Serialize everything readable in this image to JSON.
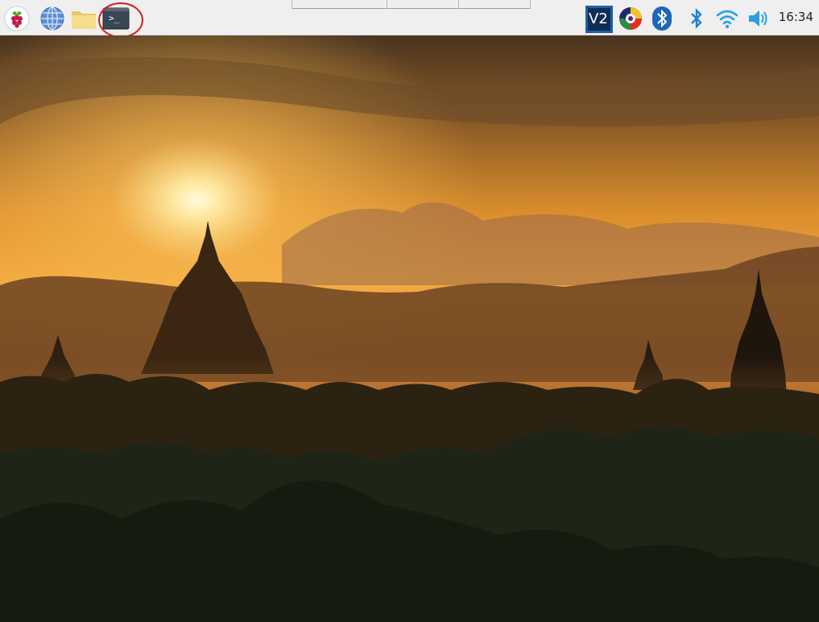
{
  "taskbar": {
    "launchers": [
      {
        "icon": "raspberry-pi-menu-icon",
        "label": ""
      },
      {
        "icon": "web-browser-icon",
        "label": ""
      },
      {
        "icon": "file-manager-icon",
        "label": ""
      },
      {
        "icon": "terminal-icon",
        "label": ">_"
      }
    ],
    "tray": [
      {
        "icon": "vnc-server-icon",
        "label": "V2"
      },
      {
        "icon": "color-wheel-icon"
      },
      {
        "icon": "bluetooth-app-icon"
      },
      {
        "icon": "bluetooth-icon"
      },
      {
        "icon": "wifi-icon"
      },
      {
        "icon": "volume-icon"
      }
    ],
    "clock": "16:34",
    "highlight_color": "#d61b1b"
  },
  "desktop": {
    "wallpaper": "sunset-over-temples",
    "colors": {
      "sky_top": "#3a2a1a",
      "sky_glow": "#f6c25a",
      "sun": "#fff6cc",
      "mountains": "#5b3a1e",
      "silhouette": "#1c140c",
      "trees": "#1f2516"
    }
  }
}
